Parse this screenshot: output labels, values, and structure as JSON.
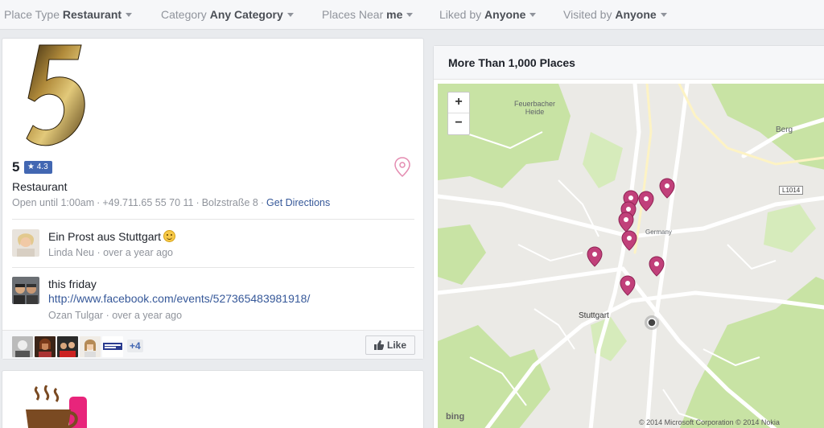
{
  "filters": [
    {
      "prefix": "Place Type",
      "value": "Restaurant"
    },
    {
      "prefix": "Category",
      "value": "Any Category"
    },
    {
      "prefix": "Places Near",
      "value": "me"
    },
    {
      "prefix": "Liked by",
      "value": "Anyone"
    },
    {
      "prefix": "Visited by",
      "value": "Anyone"
    }
  ],
  "place": {
    "name": "5",
    "rating": "★ 4.3",
    "category": "Restaurant",
    "hours": "Open until 1:00am",
    "phone": "+49.711.65 55 70 11",
    "address": "Bolzstraße 8",
    "directions": "Get Directions",
    "posts": [
      {
        "text": "Ein Prost aus Stuttgart",
        "author": "Linda Neu",
        "time": "over a year ago"
      },
      {
        "text": "this friday",
        "link": "http://www.facebook.com/events/527365483981918/",
        "author": "Ozan Tulgar",
        "time": "over a year ago"
      }
    ],
    "friends_more": "+4",
    "like_label": "Like"
  },
  "map": {
    "title": "More Than 1,000 Places",
    "zoom_in": "+",
    "zoom_out": "−",
    "labels": {
      "heide": "Feuerbacher\nHeide",
      "berg": "Berg",
      "stuttgart": "Stuttgart",
      "germany": "Germany",
      "road": "L1014",
      "bing": "bing",
      "copyright": "© 2014 Microsoft Corporation  © 2014 Nokia"
    },
    "pin_color": "#c1407a"
  }
}
